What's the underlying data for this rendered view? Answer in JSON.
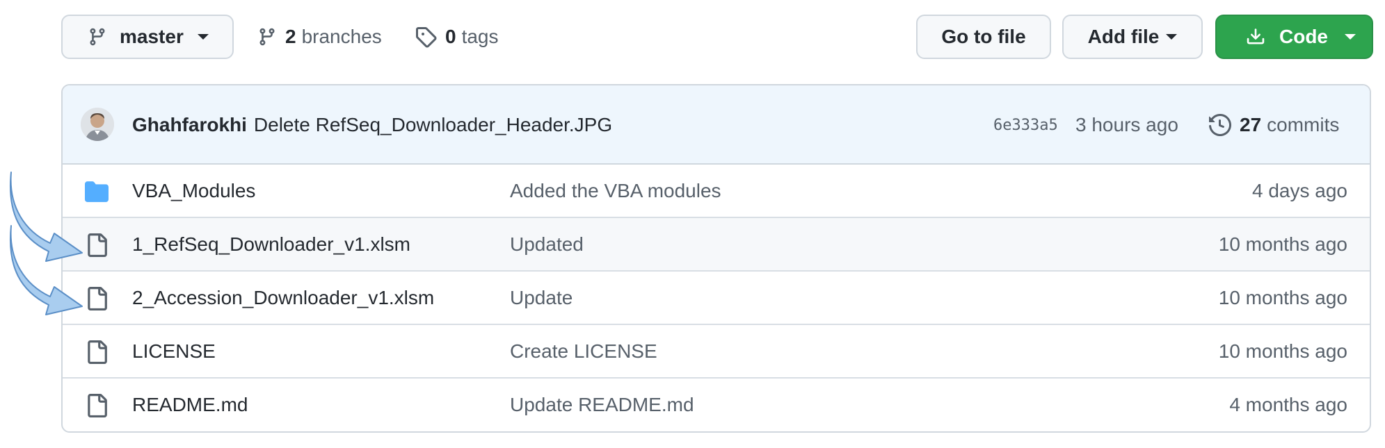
{
  "toolbar": {
    "branch_name": "master",
    "branch_count": "2",
    "branch_label": "branches",
    "tag_count": "0",
    "tag_label": "tags",
    "go_to_file": "Go to file",
    "add_file": "Add file",
    "code": "Code"
  },
  "commit": {
    "author": "Ghahfarokhi",
    "message": "Delete RefSeq_Downloader_Header.JPG",
    "sha": "6e333a5",
    "time": "3 hours ago",
    "count": "27",
    "count_label": "commits"
  },
  "files": [
    {
      "type": "folder",
      "name": "VBA_Modules",
      "message": "Added the VBA modules",
      "age": "4 days ago"
    },
    {
      "type": "file",
      "name": "1_RefSeq_Downloader_v1.xlsm",
      "message": "Updated",
      "age": "10 months ago"
    },
    {
      "type": "file",
      "name": "2_Accession_Downloader_v1.xlsm",
      "message": "Update",
      "age": "10 months ago"
    },
    {
      "type": "file",
      "name": "LICENSE",
      "message": "Create LICENSE",
      "age": "10 months ago"
    },
    {
      "type": "file",
      "name": "README.md",
      "message": "Update README.md",
      "age": "4 months ago"
    }
  ],
  "colors": {
    "code_button": "#2da44e",
    "folder_icon": "#54aeff",
    "annotation_arrow": "#a9cdef"
  }
}
